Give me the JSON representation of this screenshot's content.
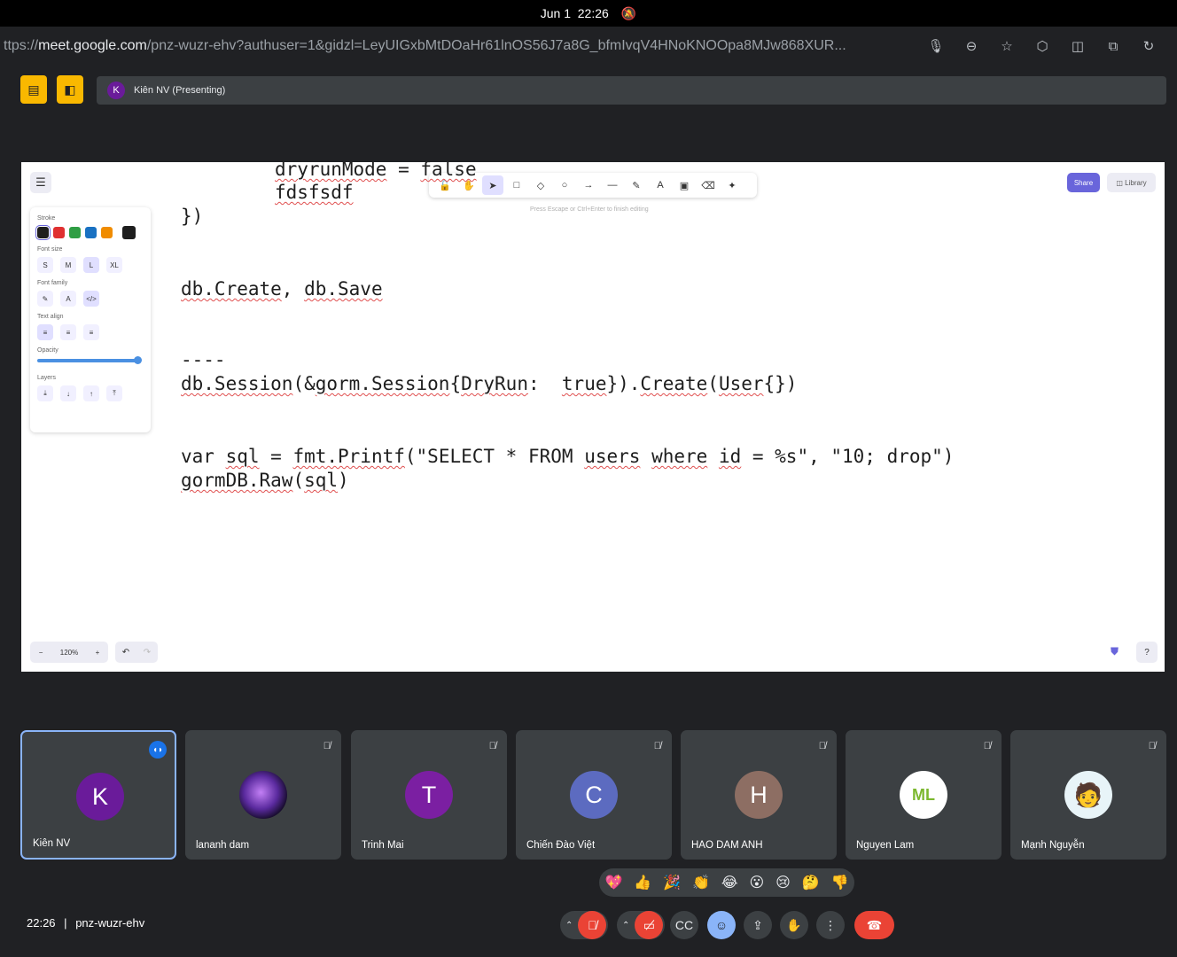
{
  "system": {
    "date": "Jun 1",
    "time": "22:26",
    "bell_icon": "bell-off-icon"
  },
  "browser": {
    "url_prefix": "ttps://",
    "url_domain": "meet.google.com",
    "url_path": "/pnz-wuzr-ehv?authuser=1&gidzl=LeyUIGxbMtDOaHr61lnOS56J7a8G_bfmIvqV4HNoKNOOpa8MJw868XUR..."
  },
  "presentation": {
    "presenter_initial": "K",
    "label": "Kiên NV (Presenting)"
  },
  "whiteboard": {
    "toolbar_hint": "Press Escape or Ctrl+Enter to finish editing",
    "share_label": "Share",
    "library_label": "Library",
    "props": {
      "stroke_label": "Stroke",
      "stroke_colors": [
        "#1e1e1e",
        "#e03131",
        "#2f9e44",
        "#1971c2",
        "#f08c00",
        "#1e1e1e"
      ],
      "font_size_label": "Font size",
      "font_sizes": [
        "S",
        "M",
        "L",
        "XL"
      ],
      "font_family_label": "Font family",
      "text_align_label": "Text align",
      "opacity_label": "Opacity",
      "layers_label": "Layers"
    },
    "code_lines": {
      "line1a": "dryrunMode",
      "line1b": " = ",
      "line1c": "false",
      "line2": "fdsfsdf",
      "line3": "})",
      "line4a": "db.Create",
      "line4b": ", ",
      "line4c": "db.Save",
      "line5": "----",
      "line6a": "db.Session",
      "line6b": "(&",
      "line6c": "gorm.Session",
      "line6d": "{",
      "line6e": "DryRun",
      "line6f": ":  ",
      "line6g": "true",
      "line6h": "}).",
      "line6i": "Create",
      "line6j": "(",
      "line6k": "User",
      "line6l": "{})",
      "line7a": "var ",
      "line7b": "sql",
      "line7c": " = ",
      "line7d": "fmt.Printf",
      "line7e": "(\"SELECT * FROM ",
      "line7f": "users",
      "line7g": " ",
      "line7h": "where",
      "line7i": " ",
      "line7j": "id",
      "line7k": " = %s\", \"10; drop\")",
      "line8a": "gormDB.Raw",
      "line8b": "(",
      "line8c": "sql",
      "line8d": ")"
    },
    "zoom_level": "120%"
  },
  "participants": [
    {
      "name": "Kiên NV",
      "initial": "K",
      "color": "#6a1b9a"
    },
    {
      "name": "lananh dam",
      "initial": "",
      "color": "#2b1a4a"
    },
    {
      "name": "Trinh Mai",
      "initial": "T",
      "color": "#7b1fa2"
    },
    {
      "name": "Chiến Đào Việt",
      "initial": "C",
      "color": "#5c6bc0"
    },
    {
      "name": "HAO DAM ANH",
      "initial": "H",
      "color": "#8d6e63"
    },
    {
      "name": "Nguyen Lam",
      "initial": "ML",
      "color": "#ffffff"
    },
    {
      "name": "Mạnh Nguyễn",
      "initial": "",
      "color": "#e8f4f8"
    }
  ],
  "reactions": [
    "💖",
    "👍",
    "🎉",
    "👏",
    "😂",
    "😮",
    "😢",
    "🤔",
    "👎"
  ],
  "meeting": {
    "time": "22:26",
    "separator": "|",
    "code": "pnz-wuzr-ehv"
  },
  "colors": {
    "accent": "#6965db",
    "end_call": "#ea4335",
    "highlight": "#f9b800"
  }
}
